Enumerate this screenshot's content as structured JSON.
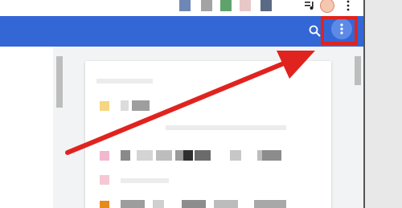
{
  "browser": {
    "toolbar_icons": [
      "playlist-icon",
      "avatar",
      "more-vert-icon"
    ],
    "bookmark_swatches": [
      "#6f87b5",
      "#a3a3a3",
      "#5fa36b",
      "#e7c7c7",
      "#5b6a84"
    ]
  },
  "app_bar": {
    "color": "#3367d6",
    "search_icon": "search-icon",
    "menu_icon": "more-vert-icon"
  },
  "annotation": {
    "highlight_color": "#e0231f",
    "arrow_color": "#e0231f",
    "target": "menu-button"
  },
  "list": {
    "items": [
      {
        "icon_color": "#f6d680"
      },
      {
        "icon_color": "#f3b7cf"
      },
      {
        "icon_color": "#f6c8d6"
      },
      {
        "icon_color": "#e68a1a"
      }
    ]
  }
}
